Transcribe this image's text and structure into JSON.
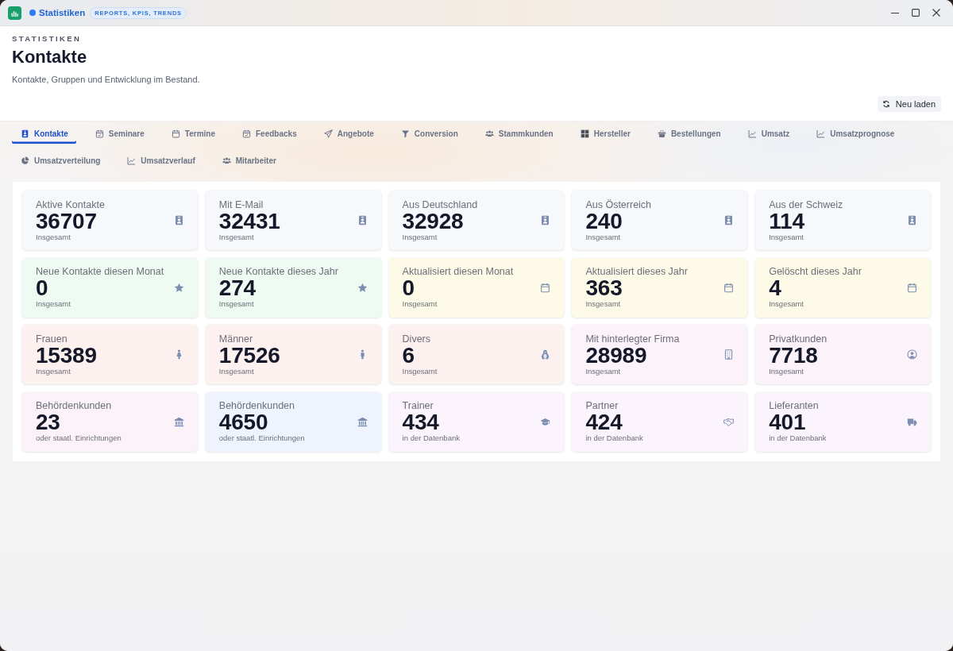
{
  "window": {
    "title": "Statistiken",
    "badge": "REPORTS, KPIS, TRENDS"
  },
  "header": {
    "eyebrow": "STATISTIKEN",
    "title": "Kontakte",
    "subtitle": "Kontakte, Gruppen und Entwicklung im Bestand.",
    "reload_button": "Neu laden"
  },
  "tabs": [
    {
      "label": "Kontakte",
      "selected": true
    },
    {
      "label": "Seminare",
      "selected": false
    },
    {
      "label": "Termine",
      "selected": false
    },
    {
      "label": "Feedbacks",
      "selected": false
    },
    {
      "label": "Angebote",
      "selected": false
    },
    {
      "label": "Conversion",
      "selected": false
    },
    {
      "label": "Stammkunden",
      "selected": false
    },
    {
      "label": "Hersteller",
      "selected": false
    },
    {
      "label": "Bestellungen",
      "selected": false
    },
    {
      "label": "Umsatz",
      "selected": false
    },
    {
      "label": "Umsatzprognose",
      "selected": false
    },
    {
      "label": "Umsatzverteilung",
      "selected": false
    },
    {
      "label": "Umsatzverlauf",
      "selected": false
    },
    {
      "label": "Mitarbeiter",
      "selected": false
    }
  ],
  "cards": [
    {
      "label": "Aktive Kontakte",
      "value": "36707",
      "note": "Insgesamt",
      "color": "#f6f8fb"
    },
    {
      "label": "Mit E-Mail",
      "value": "32431",
      "note": "Insgesamt",
      "color": "#f6f8fb"
    },
    {
      "label": "Aus Deutschland",
      "value": "32928",
      "note": "Insgesamt",
      "color": "#f6f8fb"
    },
    {
      "label": "Aus Österreich",
      "value": "240",
      "note": "Insgesamt",
      "color": "#f6f8fb"
    },
    {
      "label": "Aus der Schweiz",
      "value": "114",
      "note": "Insgesamt",
      "color": "#f6f8fb"
    },
    {
      "label": "Neue Kontakte diesen Monat",
      "value": "0",
      "note": "Insgesamt",
      "color": "#eefaf2"
    },
    {
      "label": "Neue Kontakte dieses Jahr",
      "value": "274",
      "note": "Insgesamt",
      "color": "#eefaf2"
    },
    {
      "label": "Aktualisiert diesen Monat",
      "value": "0",
      "note": "Insgesamt",
      "color": "#fdfbe8"
    },
    {
      "label": "Aktualisiert dieses Jahr",
      "value": "363",
      "note": "Insgesamt",
      "color": "#fdfbe8"
    },
    {
      "label": "Gelöscht dieses Jahr",
      "value": "4",
      "note": "Insgesamt",
      "color": "#fdfbe8"
    },
    {
      "label": "Frauen",
      "value": "15389",
      "note": "Insgesamt",
      "color": "#fdf1f0"
    },
    {
      "label": "Männer",
      "value": "17526",
      "note": "Insgesamt",
      "color": "#fdf1f0"
    },
    {
      "label": "Divers",
      "value": "6",
      "note": "Insgesamt",
      "color": "#fdf1f0"
    },
    {
      "label": "Mit hinterlegter Firma",
      "value": "28989",
      "note": "Insgesamt",
      "color": "#fbf2fa"
    },
    {
      "label": "Privatkunden",
      "value": "7718",
      "note": "Insgesamt",
      "color": "#fbf2fa"
    },
    {
      "label": "Behördenkunden",
      "value": "23",
      "note": "oder staatl. Einrichtungen",
      "color": "#fcf3fa"
    },
    {
      "label": "Behördenkunden",
      "value": "4650",
      "note": "oder staatl. Einrichtungen",
      "color": "#eef3fd"
    },
    {
      "label": "Trainer",
      "value": "434",
      "note": "in der Datenbank",
      "color": "#fbf4fc"
    },
    {
      "label": "Partner",
      "value": "424",
      "note": "in der Datenbank",
      "color": "#fbf4fc"
    },
    {
      "label": "Lieferanten",
      "value": "401",
      "note": "in der Datenbank",
      "color": "#fbf4fc"
    }
  ]
}
